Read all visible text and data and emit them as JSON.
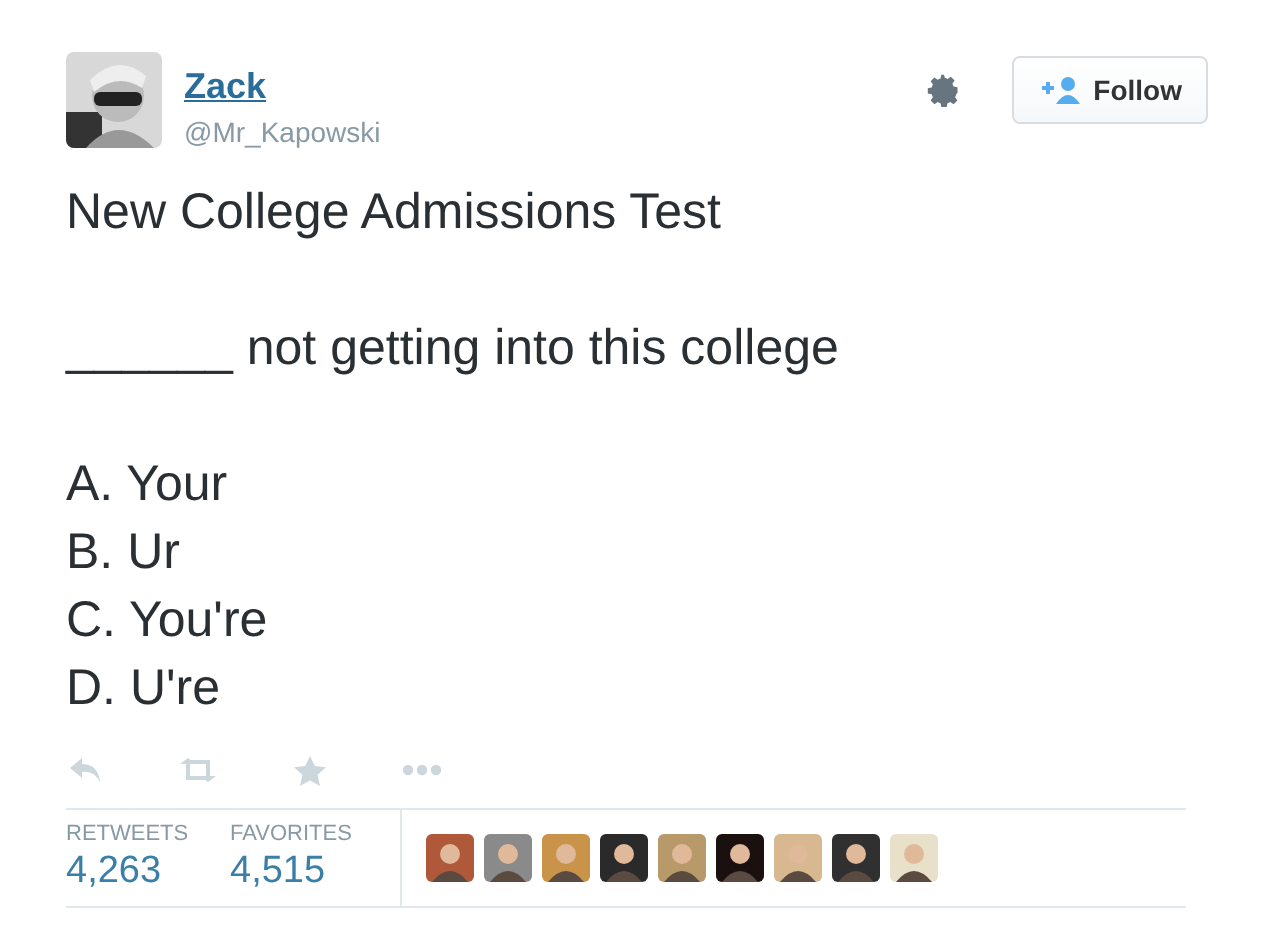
{
  "user": {
    "name": "Zack",
    "handle": "@Mr_Kapowski"
  },
  "follow_button": {
    "label": "Follow"
  },
  "tweet_paragraphs": [
    [
      "New College Admissions Test"
    ],
    [
      "______ not getting into this college"
    ],
    [
      "A. Your",
      "B. Ur",
      "C. You're",
      "D. U're"
    ]
  ],
  "stats": [
    {
      "label": "RETWEETS",
      "value": "4,263"
    },
    {
      "label": "FAVORITES",
      "value": "4,515"
    }
  ],
  "favoriters": [
    {
      "kind": "picture"
    },
    {
      "kind": "picture"
    },
    {
      "kind": "picture"
    },
    {
      "kind": "picture"
    },
    {
      "kind": "picture"
    },
    {
      "kind": "picture"
    },
    {
      "kind": "picture"
    },
    {
      "kind": "picture"
    },
    {
      "kind": "picture"
    }
  ]
}
